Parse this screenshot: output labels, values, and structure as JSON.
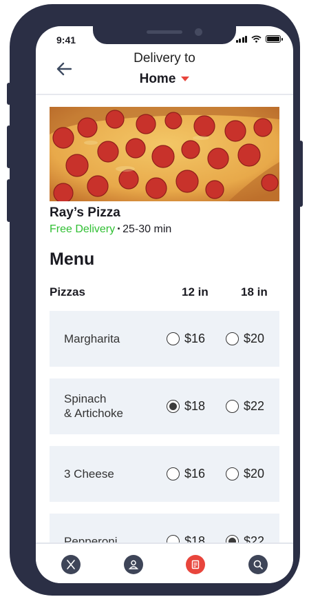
{
  "status": {
    "time": "9:41"
  },
  "header": {
    "label": "Delivery to",
    "location": "Home"
  },
  "restaurant": {
    "name": "Ray’s Pizza",
    "delivery": "Free Delivery",
    "time_range": "25-30 min"
  },
  "menu": {
    "title": "Menu",
    "category": "Pizzas",
    "sizes": [
      "12 in",
      "18 in"
    ],
    "items": [
      {
        "name": "Margharita",
        "price_small": "$16",
        "price_large": "$20",
        "selected": "none"
      },
      {
        "name_line1": "Spinach",
        "name_line2": "& Artichoke",
        "price_small": "$18",
        "price_large": "$22",
        "selected": "small"
      },
      {
        "name": "3 Cheese",
        "price_small": "$16",
        "price_large": "$20",
        "selected": "none"
      },
      {
        "name": "Pepperoni",
        "price_small": "$18",
        "price_large": "$22",
        "selected": "large"
      }
    ]
  },
  "tabbar": {
    "tabs": [
      {
        "icon": "utensils-icon",
        "active": false
      },
      {
        "icon": "user-icon",
        "active": false
      },
      {
        "icon": "receipt-icon",
        "active": true
      },
      {
        "icon": "search-icon",
        "active": false
      }
    ]
  },
  "colors": {
    "accent": "#e8453c",
    "free_delivery": "#2fbf32",
    "card_bg": "#eef2f7",
    "frame": "#2b2f45"
  }
}
